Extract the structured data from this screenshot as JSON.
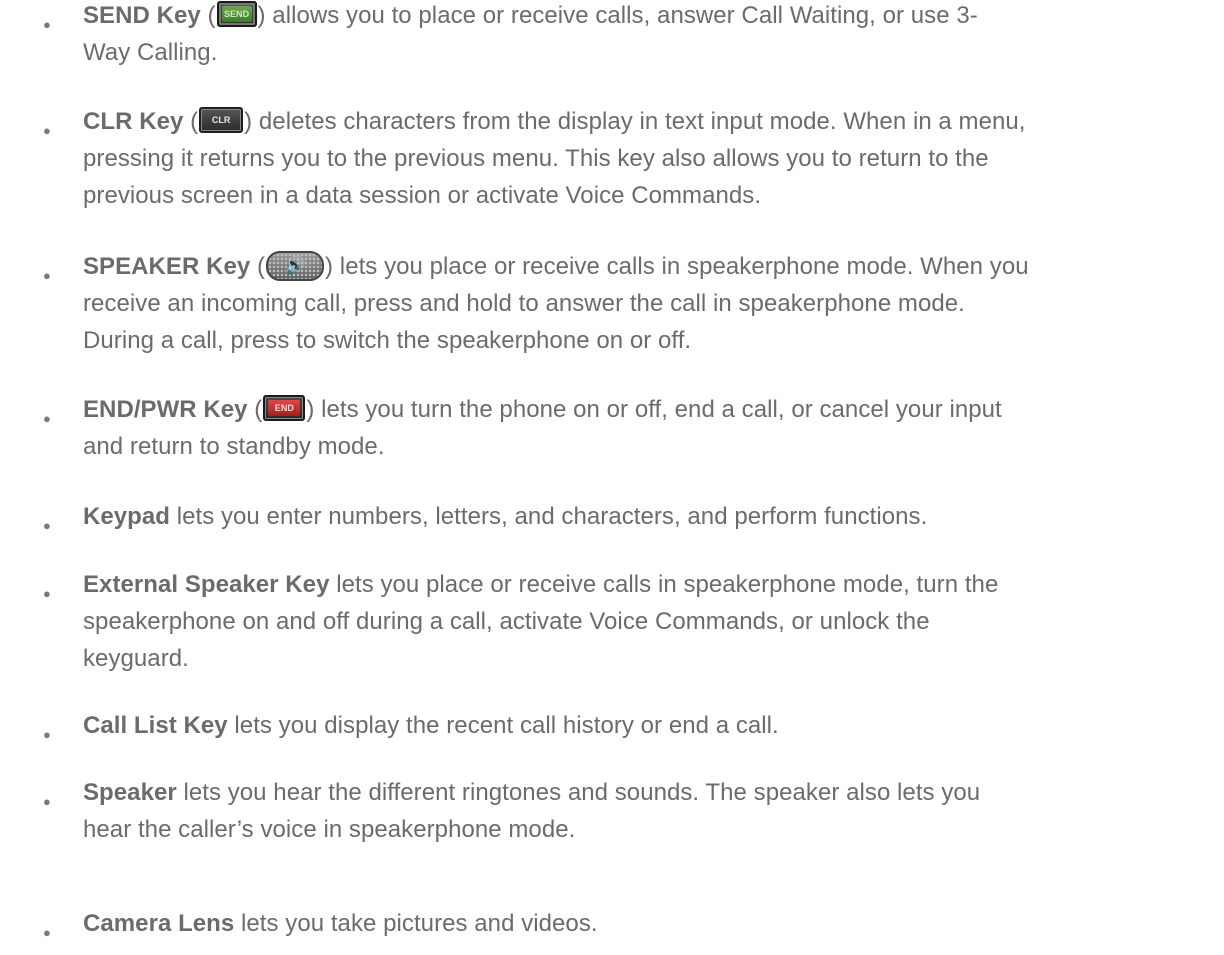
{
  "bullet_glyph": "●",
  "items": [
    {
      "term": "SEND Key",
      "icon": "send-key",
      "icon_label": "SEND",
      "line1_pre": " (",
      "line1_post": ") allows you to place or receive calls, answer Call Waiting, or use 3-",
      "lines": [
        "Way Calling."
      ]
    },
    {
      "term": "CLR Key",
      "icon": "clr-key",
      "icon_label": "CLR",
      "line1_pre": " (",
      "line1_post": ") deletes characters from the display in text input mode. When in a menu,",
      "lines": [
        "pressing it returns you to the previous menu. This key also allows you to return to the",
        "previous screen in a data session or activate Voice Commands."
      ]
    },
    {
      "term": "SPEAKER Key",
      "icon": "speaker-key",
      "line1_pre": " (",
      "line1_post": ") lets you place or receive calls in speakerphone mode. When you",
      "lines": [
        "receive an incoming call, press and hold to answer the call in speakerphone mode.",
        "During a call, press to switch the speakerphone on or off."
      ]
    },
    {
      "term": "END/PWR Key",
      "icon": "end-power-key",
      "icon_label": "END",
      "line1_pre": " (",
      "line1_post": ") lets you turn the phone on or off, end a call, or cancel your input",
      "lines": [
        "and return to standby mode."
      ]
    },
    {
      "term": "Keypad",
      "line1_post": " lets you enter numbers, letters, and characters, and perform functions.",
      "lines": []
    },
    {
      "term": "External Speaker Key",
      "line1_post": " lets you place or receive calls in speakerphone mode, turn the",
      "lines": [
        "speakerphone on and off during a call, activate Voice Commands, or unlock the",
        "keyguard."
      ]
    },
    {
      "term": "Call List Key",
      "line1_post": " lets you display the recent call history or end a call.",
      "lines": []
    },
    {
      "term": "Speaker",
      "line1_post": " lets you hear the different ringtones and sounds. The speaker also lets you",
      "lines": [
        "hear the caller’s voice in speakerphone mode."
      ]
    },
    {
      "term": "Camera Lens",
      "line1_post": " lets you take pictures and videos.",
      "lines": []
    }
  ]
}
